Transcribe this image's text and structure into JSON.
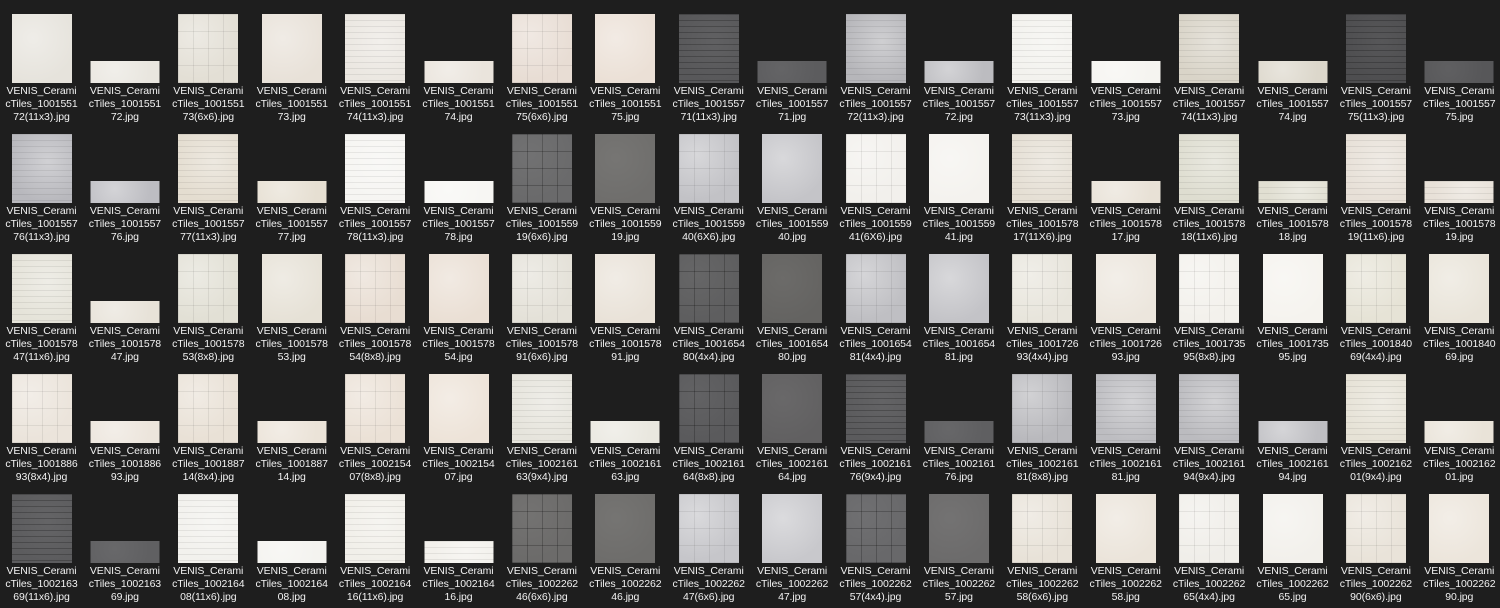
{
  "window": {
    "view": "large-icons"
  },
  "tiles": [
    {
      "l1": "VENIS_Cerami",
      "l2": "cTiles_1001551",
      "l3": "72(11x3).jpg",
      "shape": "sq",
      "color": "#e6e3dc",
      "pattern": "plain"
    },
    {
      "l1": "VENIS_Cerami",
      "l2": "cTiles_1001551",
      "l3": "72.jpg",
      "shape": "wide",
      "color": "#e9e6df",
      "pattern": "plain"
    },
    {
      "l1": "VENIS_Cerami",
      "l2": "cTiles_1001551",
      "l3": "73(6x6).jpg",
      "shape": "sq",
      "color": "#e3dfd5",
      "pattern": "grid"
    },
    {
      "l1": "VENIS_Cerami",
      "l2": "cTiles_1001551",
      "l3": "73.jpg",
      "shape": "sq",
      "color": "#e8e1d8",
      "pattern": "plain"
    },
    {
      "l1": "VENIS_Cerami",
      "l2": "cTiles_1001551",
      "l3": "74(11x3).jpg",
      "shape": "sq",
      "color": "#ebe7e1",
      "pattern": "stripe"
    },
    {
      "l1": "VENIS_Cerami",
      "l2": "cTiles_1001551",
      "l3": "74.jpg",
      "shape": "wide",
      "color": "#eae4dc",
      "pattern": "plain"
    },
    {
      "l1": "VENIS_Cerami",
      "l2": "cTiles_1001551",
      "l3": "75(6x6).jpg",
      "shape": "sq",
      "color": "#e8ddd4",
      "pattern": "grid"
    },
    {
      "l1": "VENIS_Cerami",
      "l2": "cTiles_1001551",
      "l3": "75.jpg",
      "shape": "sq",
      "color": "#ebe0d6",
      "pattern": "plain"
    },
    {
      "l1": "VENIS_Cerami",
      "l2": "cTiles_1001557",
      "l3": "71(11x3).jpg",
      "shape": "sq",
      "color": "#58585a",
      "pattern": "stripe"
    },
    {
      "l1": "VENIS_Cerami",
      "l2": "cTiles_1001557",
      "l3": "71.jpg",
      "shape": "wide",
      "color": "#5c5c5e",
      "pattern": "plain"
    },
    {
      "l1": "VENIS_Cerami",
      "l2": "cTiles_1001557",
      "l3": "72(11x3).jpg",
      "shape": "sq",
      "color": "#b6b6ba",
      "pattern": "stripe"
    },
    {
      "l1": "VENIS_Cerami",
      "l2": "cTiles_1001557",
      "l3": "72.jpg",
      "shape": "wide",
      "color": "#bcbcc0",
      "pattern": "plain"
    },
    {
      "l1": "VENIS_Cerami",
      "l2": "cTiles_1001557",
      "l3": "73(11x3).jpg",
      "shape": "sq",
      "color": "#f3f2ee",
      "pattern": "stripe"
    },
    {
      "l1": "VENIS_Cerami",
      "l2": "cTiles_1001557",
      "l3": "73.jpg",
      "shape": "wide",
      "color": "#f5f4f0",
      "pattern": "plain"
    },
    {
      "l1": "VENIS_Cerami",
      "l2": "cTiles_1001557",
      "l3": "74(11x3).jpg",
      "shape": "sq",
      "color": "#d9d4c8",
      "pattern": "stripe"
    },
    {
      "l1": "VENIS_Cerami",
      "l2": "cTiles_1001557",
      "l3": "74.jpg",
      "shape": "wide",
      "color": "#dcd7cb",
      "pattern": "plain"
    },
    {
      "l1": "VENIS_Cerami",
      "l2": "cTiles_1001557",
      "l3": "75(11x3).jpg",
      "shape": "sq",
      "color": "#4e4e50",
      "pattern": "stripe"
    },
    {
      "l1": "VENIS_Cerami",
      "l2": "cTiles_1001557",
      "l3": "75.jpg",
      "shape": "wide",
      "color": "#575759",
      "pattern": "plain"
    },
    {
      "l1": "VENIS_Cerami",
      "l2": "cTiles_1001557",
      "l3": "76(11x3).jpg",
      "shape": "sq",
      "color": "#b8b8bd",
      "pattern": "stripe"
    },
    {
      "l1": "VENIS_Cerami",
      "l2": "cTiles_1001557",
      "l3": "76.jpg",
      "shape": "wide",
      "color": "#bdbdc2",
      "pattern": "plain"
    },
    {
      "l1": "VENIS_Cerami",
      "l2": "cTiles_1001557",
      "l3": "77(11x3).jpg",
      "shape": "sq",
      "color": "#e4ddd0",
      "pattern": "stripe"
    },
    {
      "l1": "VENIS_Cerami",
      "l2": "cTiles_1001557",
      "l3": "77.jpg",
      "shape": "wide",
      "color": "#e6dfd2",
      "pattern": "plain"
    },
    {
      "l1": "VENIS_Cerami",
      "l2": "cTiles_1001557",
      "l3": "78(11x3).jpg",
      "shape": "sq",
      "color": "#f6f5f2",
      "pattern": "stripe"
    },
    {
      "l1": "VENIS_Cerami",
      "l2": "cTiles_1001557",
      "l3": "78.jpg",
      "shape": "wide",
      "color": "#f7f6f3",
      "pattern": "plain"
    },
    {
      "l1": "VENIS_Cerami",
      "l2": "cTiles_1001559",
      "l3": "19(6x6).jpg",
      "shape": "sq",
      "color": "#6a6a6b",
      "pattern": "grid"
    },
    {
      "l1": "VENIS_Cerami",
      "l2": "cTiles_1001559",
      "l3": "19.jpg",
      "shape": "sq",
      "color": "#6f6e6c",
      "pattern": "plain"
    },
    {
      "l1": "VENIS_Cerami",
      "l2": "cTiles_1001559",
      "l3": "40(6X6).jpg",
      "shape": "sq",
      "color": "#c2c2c6",
      "pattern": "grid"
    },
    {
      "l1": "VENIS_Cerami",
      "l2": "cTiles_1001559",
      "l3": "40.jpg",
      "shape": "sq",
      "color": "#c4c4c8",
      "pattern": "plain"
    },
    {
      "l1": "VENIS_Cerami",
      "l2": "cTiles_1001559",
      "l3": "41(6X6).jpg",
      "shape": "sq",
      "color": "#f2f0ec",
      "pattern": "grid"
    },
    {
      "l1": "VENIS_Cerami",
      "l2": "cTiles_1001559",
      "l3": "41.jpg",
      "shape": "sq",
      "color": "#f4f2ee",
      "pattern": "plain"
    },
    {
      "l1": "VENIS_Cerami",
      "l2": "cTiles_1001578",
      "l3": "17(11X6).jpg",
      "shape": "sq",
      "color": "#e5dfd4",
      "pattern": "stripe"
    },
    {
      "l1": "VENIS_Cerami",
      "l2": "cTiles_1001578",
      "l3": "17.jpg",
      "shape": "wide",
      "color": "#e8e1d6",
      "pattern": "plain"
    },
    {
      "l1": "VENIS_Cerami",
      "l2": "cTiles_1001578",
      "l3": "18(11x6).jpg",
      "shape": "sq",
      "color": "#deddd0",
      "pattern": "stripe"
    },
    {
      "l1": "VENIS_Cerami",
      "l2": "cTiles_1001578",
      "l3": "18.jpg",
      "shape": "wide",
      "color": "#e1dfd2",
      "pattern": "stripe"
    },
    {
      "l1": "VENIS_Cerami",
      "l2": "cTiles_1001578",
      "l3": "19(11x6).jpg",
      "shape": "sq",
      "color": "#e7e0d7",
      "pattern": "stripe"
    },
    {
      "l1": "VENIS_Cerami",
      "l2": "cTiles_1001578",
      "l3": "19.jpg",
      "shape": "wide",
      "color": "#e8e1d8",
      "pattern": "stripe"
    },
    {
      "l1": "VENIS_Cerami",
      "l2": "cTiles_1001578",
      "l3": "47(11x6).jpg",
      "shape": "sq",
      "color": "#e5e3d9",
      "pattern": "stripe"
    },
    {
      "l1": "VENIS_Cerami",
      "l2": "cTiles_1001578",
      "l3": "47.jpg",
      "shape": "wide",
      "color": "#e7e2d8",
      "pattern": "plain"
    },
    {
      "l1": "VENIS_Cerami",
      "l2": "cTiles_1001578",
      "l3": "53(8x8).jpg",
      "shape": "sq",
      "color": "#e2e0d5",
      "pattern": "grid"
    },
    {
      "l1": "VENIS_Cerami",
      "l2": "cTiles_1001578",
      "l3": "53.jpg",
      "shape": "sq",
      "color": "#e6e1d6",
      "pattern": "plain"
    },
    {
      "l1": "VENIS_Cerami",
      "l2": "cTiles_1001578",
      "l3": "54(8x8).jpg",
      "shape": "sq",
      "color": "#e8ddd2",
      "pattern": "grid"
    },
    {
      "l1": "VENIS_Cerami",
      "l2": "cTiles_1001578",
      "l3": "54.jpg",
      "shape": "sq",
      "color": "#eadfd4",
      "pattern": "plain"
    },
    {
      "l1": "VENIS_Cerami",
      "l2": "cTiles_1001578",
      "l3": "91(6x6).jpg",
      "shape": "sq",
      "color": "#e4e1d8",
      "pattern": "grid"
    },
    {
      "l1": "VENIS_Cerami",
      "l2": "cTiles_1001578",
      "l3": "91.jpg",
      "shape": "sq",
      "color": "#e9e2d8",
      "pattern": "plain"
    },
    {
      "l1": "VENIS_Cerami",
      "l2": "cTiles_1001654",
      "l3": "80(4x4).jpg",
      "shape": "sq",
      "color": "#5e5e5f",
      "pattern": "grid"
    },
    {
      "l1": "VENIS_Cerami",
      "l2": "cTiles_1001654",
      "l3": "80.jpg",
      "shape": "sq",
      "color": "#646361",
      "pattern": "plain"
    },
    {
      "l1": "VENIS_Cerami",
      "l2": "cTiles_1001654",
      "l3": "81(4x4).jpg",
      "shape": "sq",
      "color": "#bfbfc3",
      "pattern": "grid"
    },
    {
      "l1": "VENIS_Cerami",
      "l2": "cTiles_1001654",
      "l3": "81.jpg",
      "shape": "sq",
      "color": "#c3c3c7",
      "pattern": "plain"
    },
    {
      "l1": "VENIS_Cerami",
      "l2": "cTiles_1001726",
      "l3": "93(4x4).jpg",
      "shape": "sq",
      "color": "#e8e5dc",
      "pattern": "grid"
    },
    {
      "l1": "VENIS_Cerami",
      "l2": "cTiles_1001726",
      "l3": "93.jpg",
      "shape": "sq",
      "color": "#ece6dd",
      "pattern": "plain"
    },
    {
      "l1": "VENIS_Cerami",
      "l2": "cTiles_1001735",
      "l3": "95(8x8).jpg",
      "shape": "sq",
      "color": "#f3f1ec",
      "pattern": "grid"
    },
    {
      "l1": "VENIS_Cerami",
      "l2": "cTiles_1001735",
      "l3": "95.jpg",
      "shape": "sq",
      "color": "#f5f3ee",
      "pattern": "plain"
    },
    {
      "l1": "VENIS_Cerami",
      "l2": "cTiles_1001840",
      "l3": "69(4x4).jpg",
      "shape": "sq",
      "color": "#e6e3d6",
      "pattern": "grid"
    },
    {
      "l1": "VENIS_Cerami",
      "l2": "cTiles_1001840",
      "l3": "69.jpg",
      "shape": "sq",
      "color": "#e9e4d9",
      "pattern": "plain"
    },
    {
      "l1": "VENIS_Cerami",
      "l2": "cTiles_1001886",
      "l3": "93(8x4).jpg",
      "shape": "sq",
      "color": "#ebe4db",
      "pattern": "grid"
    },
    {
      "l1": "VENIS_Cerami",
      "l2": "cTiles_1001886",
      "l3": "93.jpg",
      "shape": "wide",
      "color": "#ece5dc",
      "pattern": "plain"
    },
    {
      "l1": "VENIS_Cerami",
      "l2": "cTiles_1001887",
      "l3": "14(8x4).jpg",
      "shape": "sq",
      "color": "#e9e1d6",
      "pattern": "grid"
    },
    {
      "l1": "VENIS_Cerami",
      "l2": "cTiles_1001887",
      "l3": "14.jpg",
      "shape": "wide",
      "color": "#ebe3d8",
      "pattern": "plain"
    },
    {
      "l1": "VENIS_Cerami",
      "l2": "cTiles_1002154",
      "l3": "07(8x8).jpg",
      "shape": "sq",
      "color": "#ebe1d6",
      "pattern": "grid"
    },
    {
      "l1": "VENIS_Cerami",
      "l2": "cTiles_1002154",
      "l3": "07.jpg",
      "shape": "sq",
      "color": "#ede3d8",
      "pattern": "plain"
    },
    {
      "l1": "VENIS_Cerami",
      "l2": "cTiles_1002161",
      "l3": "63(9x4).jpg",
      "shape": "sq",
      "color": "#e6e4dc",
      "pattern": "stripe"
    },
    {
      "l1": "VENIS_Cerami",
      "l2": "cTiles_1002161",
      "l3": "63.jpg",
      "shape": "wide",
      "color": "#e9e7df",
      "pattern": "plain"
    },
    {
      "l1": "VENIS_Cerami",
      "l2": "cTiles_1002161",
      "l3": "64(8x8).jpg",
      "shape": "sq",
      "color": "#5a5a5c",
      "pattern": "grid"
    },
    {
      "l1": "VENIS_Cerami",
      "l2": "cTiles_1002161",
      "l3": "64.jpg",
      "shape": "sq",
      "color": "#616061",
      "pattern": "plain"
    },
    {
      "l1": "VENIS_Cerami",
      "l2": "cTiles_1002161",
      "l3": "76(9x4).jpg",
      "shape": "sq",
      "color": "#5b5b5d",
      "pattern": "stripe"
    },
    {
      "l1": "VENIS_Cerami",
      "l2": "cTiles_1002161",
      "l3": "76.jpg",
      "shape": "wide",
      "color": "#5f5f61",
      "pattern": "plain"
    },
    {
      "l1": "VENIS_Cerami",
      "l2": "cTiles_1002161",
      "l3": "81(8x8).jpg",
      "shape": "sq",
      "color": "#b9b9bd",
      "pattern": "grid"
    },
    {
      "l1": "VENIS_Cerami",
      "l2": "cTiles_1002161",
      "l3": "81.jpg",
      "shape": "sq",
      "color": "#bdbdc1",
      "pattern": "stripe"
    },
    {
      "l1": "VENIS_Cerami",
      "l2": "cTiles_1002161",
      "l3": "94(9x4).jpg",
      "shape": "sq",
      "color": "#bbbbbf",
      "pattern": "stripe"
    },
    {
      "l1": "VENIS_Cerami",
      "l2": "cTiles_1002161",
      "l3": "94.jpg",
      "shape": "wide",
      "color": "#bfbfc3",
      "pattern": "plain"
    },
    {
      "l1": "VENIS_Cerami",
      "l2": "cTiles_1002162",
      "l3": "01(9x4).jpg",
      "shape": "sq",
      "color": "#e6e2d6",
      "pattern": "stripe"
    },
    {
      "l1": "VENIS_Cerami",
      "l2": "cTiles_1002162",
      "l3": "01.jpg",
      "shape": "wide",
      "color": "#e9e3d8",
      "pattern": "plain"
    },
    {
      "l1": "VENIS_Cerami",
      "l2": "cTiles_1002163",
      "l3": "69(11x6).jpg",
      "shape": "sq",
      "color": "#5c5c5e",
      "pattern": "stripe"
    },
    {
      "l1": "VENIS_Cerami",
      "l2": "cTiles_1002163",
      "l3": "69.jpg",
      "shape": "wide",
      "color": "#606062",
      "pattern": "plain"
    },
    {
      "l1": "VENIS_Cerami",
      "l2": "cTiles_1002164",
      "l3": "08(11x6).jpg",
      "shape": "sq",
      "color": "#f2f1ed",
      "pattern": "stripe"
    },
    {
      "l1": "VENIS_Cerami",
      "l2": "cTiles_1002164",
      "l3": "08.jpg",
      "shape": "wide",
      "color": "#f4f3ef",
      "pattern": "plain"
    },
    {
      "l1": "VENIS_Cerami",
      "l2": "cTiles_1002164",
      "l3": "16(11x6).jpg",
      "shape": "sq",
      "color": "#f1efe9",
      "pattern": "stripe"
    },
    {
      "l1": "VENIS_Cerami",
      "l2": "cTiles_1002164",
      "l3": "16.jpg",
      "shape": "wide",
      "color": "#f3f1ec",
      "pattern": "stripe"
    },
    {
      "l1": "VENIS_Cerami",
      "l2": "cTiles_1002262",
      "l3": "46(6x6).jpg",
      "shape": "sq",
      "color": "#6c6b6a",
      "pattern": "grid"
    },
    {
      "l1": "VENIS_Cerami",
      "l2": "cTiles_1002262",
      "l3": "46.jpg",
      "shape": "sq",
      "color": "#6e6d6b",
      "pattern": "plain"
    },
    {
      "l1": "VENIS_Cerami",
      "l2": "cTiles_1002262",
      "l3": "47(6x6).jpg",
      "shape": "sq",
      "color": "#c6c6ca",
      "pattern": "grid"
    },
    {
      "l1": "VENIS_Cerami",
      "l2": "cTiles_1002262",
      "l3": "47.jpg",
      "shape": "sq",
      "color": "#c8c8cc",
      "pattern": "plain"
    },
    {
      "l1": "VENIS_Cerami",
      "l2": "cTiles_1002262",
      "l3": "57(4x4).jpg",
      "shape": "sq",
      "color": "#68686a",
      "pattern": "grid"
    },
    {
      "l1": "VENIS_Cerami",
      "l2": "cTiles_1002262",
      "l3": "57.jpg",
      "shape": "sq",
      "color": "#6c6b6b",
      "pattern": "plain"
    },
    {
      "l1": "VENIS_Cerami",
      "l2": "cTiles_1002262",
      "l3": "58(6x6).jpg",
      "shape": "sq",
      "color": "#e8e2d8",
      "pattern": "grid"
    },
    {
      "l1": "VENIS_Cerami",
      "l2": "cTiles_1002262",
      "l3": "58.jpg",
      "shape": "sq",
      "color": "#ebe4da",
      "pattern": "plain"
    },
    {
      "l1": "VENIS_Cerami",
      "l2": "cTiles_1002262",
      "l3": "65(4x4).jpg",
      "shape": "sq",
      "color": "#f0eee9",
      "pattern": "grid"
    },
    {
      "l1": "VENIS_Cerami",
      "l2": "cTiles_1002262",
      "l3": "65.jpg",
      "shape": "sq",
      "color": "#f2f0eb",
      "pattern": "plain"
    },
    {
      "l1": "VENIS_Cerami",
      "l2": "cTiles_1002262",
      "l3": "90(6x6).jpg",
      "shape": "sq",
      "color": "#e9e3d9",
      "pattern": "grid"
    },
    {
      "l1": "VENIS_Cerami",
      "l2": "cTiles_1002262",
      "l3": "90.jpg",
      "shape": "sq",
      "color": "#ece5db",
      "pattern": "plain"
    }
  ]
}
